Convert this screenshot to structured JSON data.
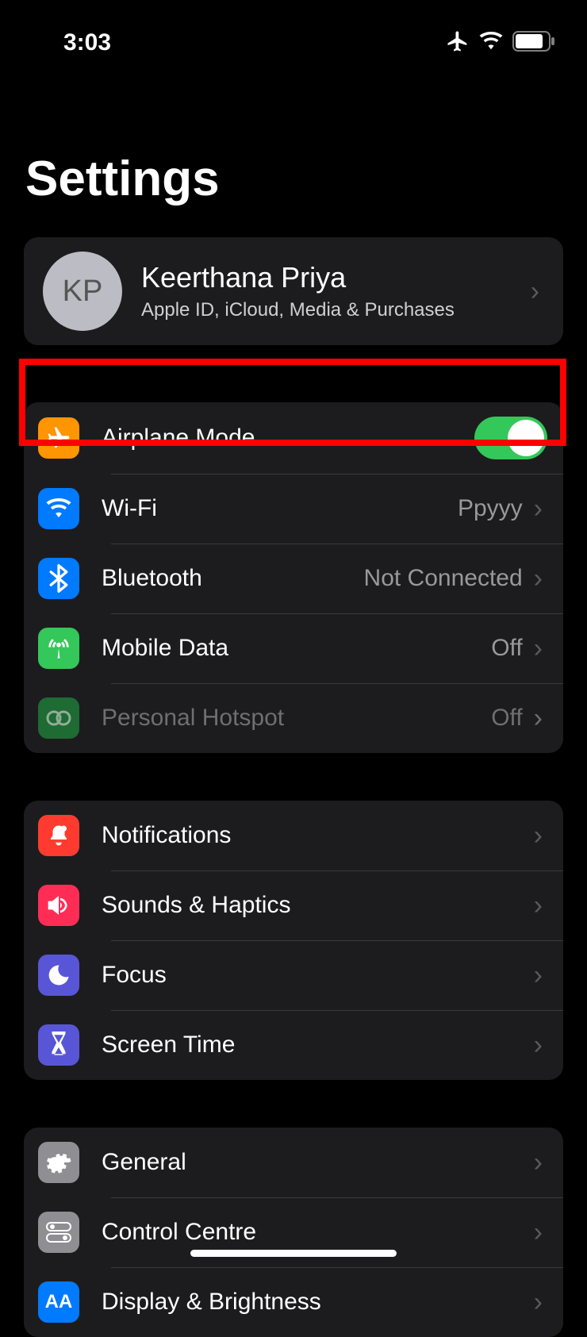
{
  "status": {
    "time": "3:03"
  },
  "title": "Settings",
  "profile": {
    "initials": "KP",
    "name": "Keerthana Priya",
    "subtitle": "Apple ID, iCloud, Media & Purchases"
  },
  "group1": {
    "airplane": {
      "label": "Airplane Mode",
      "toggle": true
    },
    "wifi": {
      "label": "Wi-Fi",
      "value": "Ppyyy"
    },
    "bluetooth": {
      "label": "Bluetooth",
      "value": "Not Connected"
    },
    "mobile_data": {
      "label": "Mobile Data",
      "value": "Off"
    },
    "hotspot": {
      "label": "Personal Hotspot",
      "value": "Off"
    }
  },
  "group2": {
    "notifications": {
      "label": "Notifications"
    },
    "sounds": {
      "label": "Sounds & Haptics"
    },
    "focus": {
      "label": "Focus"
    },
    "screen_time": {
      "label": "Screen Time"
    }
  },
  "group3": {
    "general": {
      "label": "General"
    },
    "control_centre": {
      "label": "Control Centre"
    },
    "display": {
      "label": "Display & Brightness"
    }
  }
}
